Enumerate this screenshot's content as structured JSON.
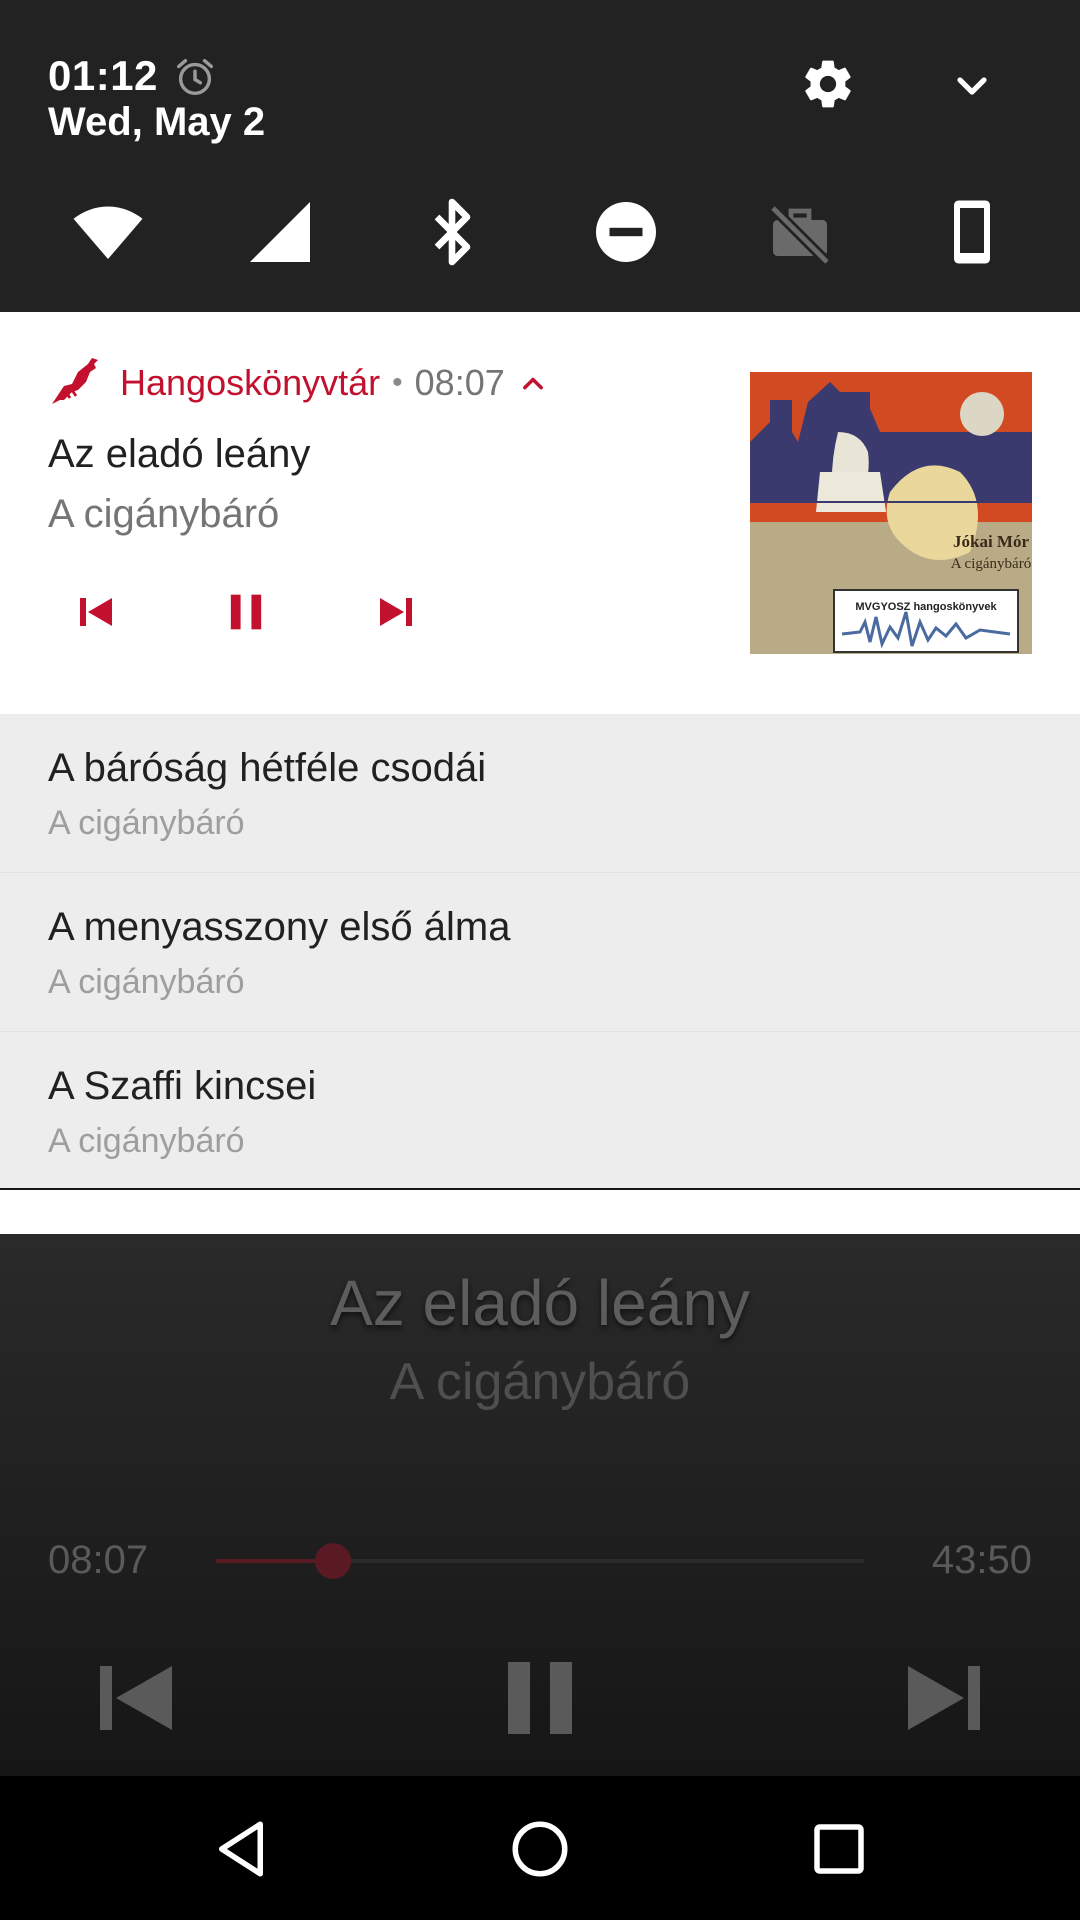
{
  "status": {
    "time": "01:12",
    "date": "Wed, May 2",
    "icons": [
      "alarm-icon",
      "settings-gear-icon",
      "expand-chevron-icon"
    ]
  },
  "quick_settings": {
    "tiles": [
      "wifi-icon",
      "cellular-signal-icon",
      "bluetooth-icon",
      "do-not-disturb-icon",
      "work-mode-off-icon",
      "auto-rotate-portrait-icon"
    ]
  },
  "notification": {
    "app_name": "Hangoskönyvtár",
    "separator": "•",
    "time": "08:07",
    "title": "Az eladó leány",
    "subtitle": "A cigánybáró",
    "actions": [
      "skip-previous-icon",
      "pause-icon",
      "skip-next-icon"
    ],
    "album_art": {
      "author": "Jókai Mór",
      "book": "A cigánybáró",
      "label": "MVGYOSZ hangoskönyvek"
    },
    "accent_color": "#c2102e"
  },
  "queue": [
    {
      "title": "A báróság hétféle csodái",
      "subtitle": "A cigánybáró"
    },
    {
      "title": "A menyasszony első álma",
      "subtitle": "A cigánybáró"
    },
    {
      "title": "A Szaffi kincsei",
      "subtitle": "A cigánybáró"
    }
  ],
  "player": {
    "title": "Az eladó leány",
    "subtitle": "A cigánybáró",
    "current_time": "08:07",
    "duration": "43:50",
    "progress": 0.18
  },
  "navbar": [
    "back-icon",
    "home-icon",
    "recents-icon"
  ]
}
